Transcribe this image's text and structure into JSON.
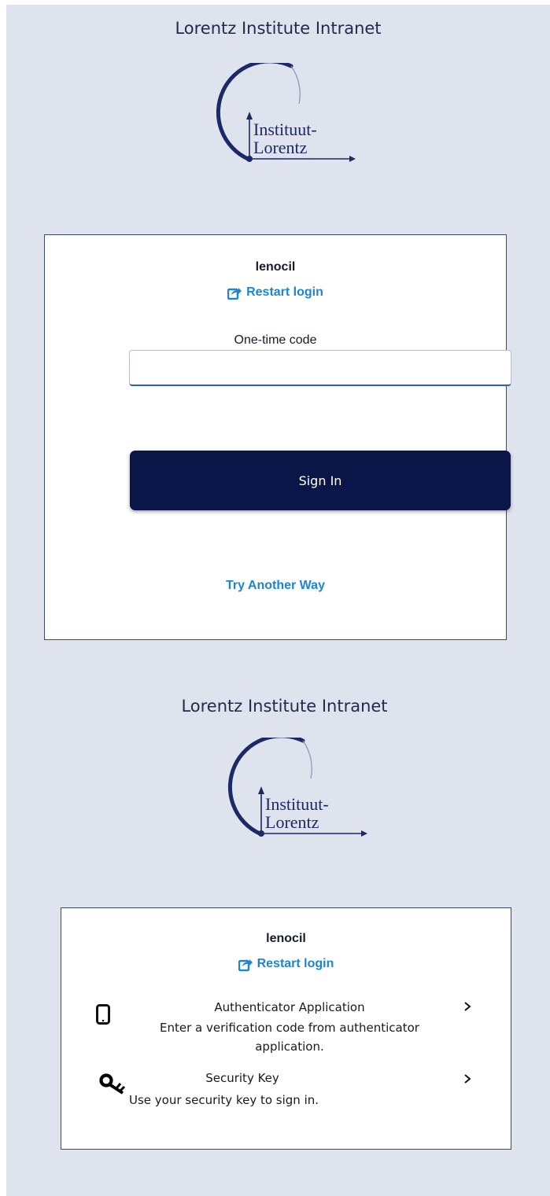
{
  "header": {
    "title": "Lorentz Institute Intranet",
    "logo_line1": "Instituut-",
    "logo_line2": "Lorentz"
  },
  "otp_card": {
    "username": "lenocil",
    "restart_label": "Restart login",
    "field_label": "One-time code",
    "field_value": "",
    "signin_label": "Sign In",
    "try_another_label": "Try Another Way"
  },
  "methods_card": {
    "username": "lenocil",
    "restart_label": "Restart login",
    "methods": [
      {
        "icon": "mobile-icon",
        "title": "Authenticator Application",
        "description": "Enter a verification code from authenticator application."
      },
      {
        "icon": "key-icon",
        "title": "Security Key",
        "description": "Use your security key to sign in."
      }
    ]
  },
  "colors": {
    "background": "#dfe3ed",
    "primary": "#0a1647",
    "link": "#1a86d2",
    "border": "#3c4a77"
  }
}
